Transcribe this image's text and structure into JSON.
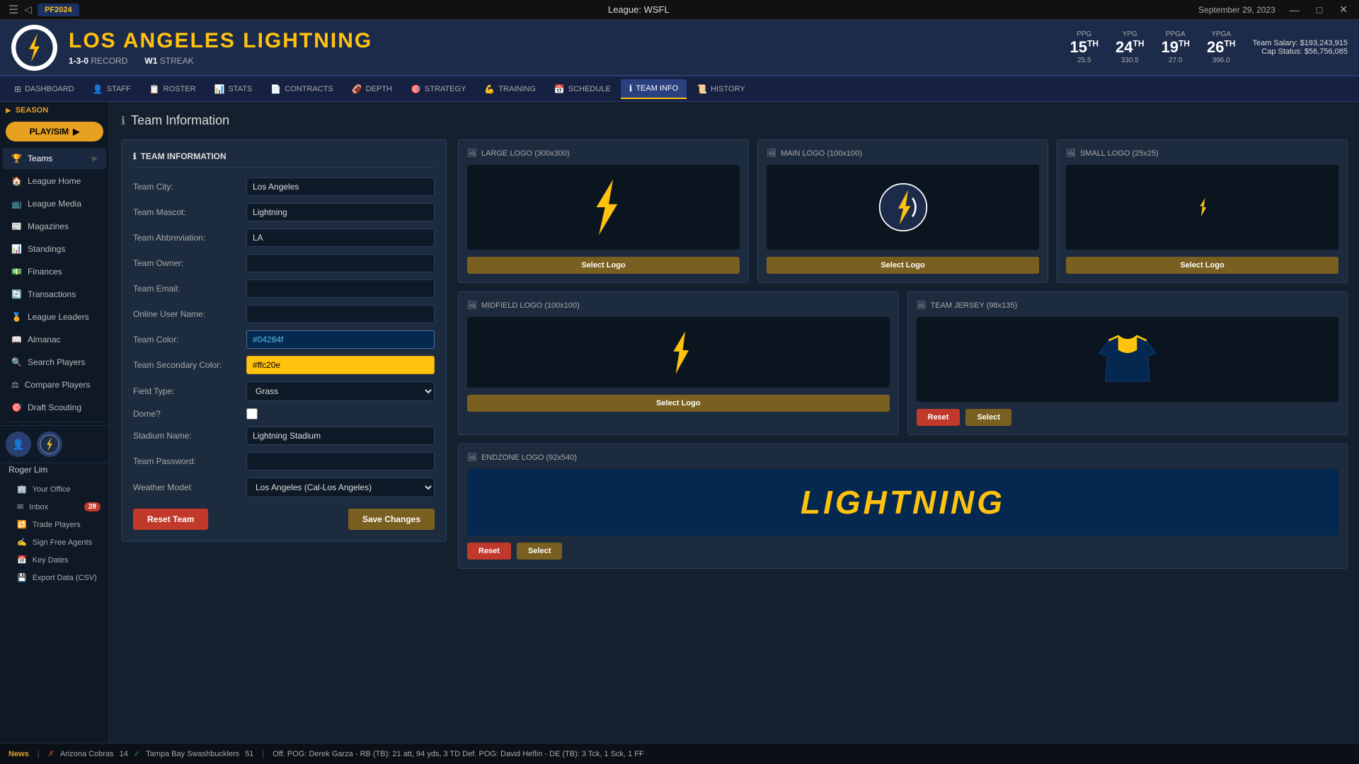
{
  "topbar": {
    "logo": "PF2024",
    "league": "League: WSFL",
    "date": "September 29, 2023",
    "minimize": "—",
    "maximize": "□",
    "close": "✕"
  },
  "header": {
    "team_city": "LOS ANGELES",
    "team_name": "LIGHTNING",
    "record": "1-3-0",
    "record_label": "RECORD",
    "streak": "W1",
    "streak_label": "STREAK",
    "stats": [
      {
        "label": "PPG",
        "rank": "15TH",
        "value": "25.5"
      },
      {
        "label": "YPG",
        "rank": "24TH",
        "value": "330.5"
      },
      {
        "label": "PPGA",
        "rank": "19TH",
        "value": "27.0"
      },
      {
        "label": "YPGA",
        "rank": "26TH",
        "value": "396.0"
      }
    ],
    "salary": "Team Salary: $193,243,915",
    "cap": "Cap Status: $56,756,085"
  },
  "nav_tabs": [
    {
      "id": "dashboard",
      "label": "DASHBOARD",
      "icon": "⊞"
    },
    {
      "id": "staff",
      "label": "STAFF",
      "icon": "👤"
    },
    {
      "id": "roster",
      "label": "ROSTER",
      "icon": "📋"
    },
    {
      "id": "stats",
      "label": "STATS",
      "icon": "📊"
    },
    {
      "id": "contracts",
      "label": "CONTRACTS",
      "icon": "📄"
    },
    {
      "id": "depth",
      "label": "DEPTH",
      "icon": "🏈"
    },
    {
      "id": "strategy",
      "label": "STRATEGY",
      "icon": "🎯"
    },
    {
      "id": "training",
      "label": "TRAINING",
      "icon": "💪"
    },
    {
      "id": "schedule",
      "label": "SCHEDULE",
      "icon": "📅"
    },
    {
      "id": "teaminfo",
      "label": "TEAM INFO",
      "icon": "ℹ"
    },
    {
      "id": "history",
      "label": "HISTORY",
      "icon": "📜"
    }
  ],
  "sidebar": {
    "season_label": "SEASON",
    "play_sim": "PLAY/SIM",
    "items": [
      {
        "id": "teams",
        "label": "Teams",
        "icon": "🏆"
      },
      {
        "id": "league-home",
        "label": "League Home",
        "icon": "🏠"
      },
      {
        "id": "league-media",
        "label": "League Media",
        "icon": "📺"
      },
      {
        "id": "magazines",
        "label": "Magazines",
        "icon": "📰"
      },
      {
        "id": "standings",
        "label": "Standings",
        "icon": "📊"
      },
      {
        "id": "finances",
        "label": "Finances",
        "icon": "💵"
      },
      {
        "id": "transactions",
        "label": "Transactions",
        "icon": "🔄"
      },
      {
        "id": "league-leaders",
        "label": "League Leaders",
        "icon": "🏅"
      },
      {
        "id": "almanac",
        "label": "Almanac",
        "icon": "📖"
      },
      {
        "id": "search-players",
        "label": "Search Players",
        "icon": "🔍"
      },
      {
        "id": "compare-players",
        "label": "Compare Players",
        "icon": "⚖"
      },
      {
        "id": "draft-scouting",
        "label": "Draft Scouting",
        "icon": "🎯"
      }
    ],
    "user_name": "Roger Lim",
    "sub_items": [
      {
        "id": "your-office",
        "label": "Your Office",
        "icon": "🏢"
      },
      {
        "id": "inbox",
        "label": "Inbox",
        "icon": "✉",
        "badge": "28"
      },
      {
        "id": "trade-players",
        "label": "Trade Players",
        "icon": "🔁"
      },
      {
        "id": "sign-free-agents",
        "label": "Sign Free Agents",
        "icon": "✍"
      },
      {
        "id": "key-dates",
        "label": "Key Dates",
        "icon": "📅"
      },
      {
        "id": "export-data",
        "label": "Export Data (CSV)",
        "icon": "💾"
      }
    ]
  },
  "page": {
    "title": "Team Information",
    "section_label": "TEAM INFORMATION",
    "fields": {
      "city_label": "Team City:",
      "city_value": "Los Angeles",
      "mascot_label": "Team Mascot:",
      "mascot_value": "Lightning",
      "abbr_label": "Team Abbreviation:",
      "abbr_value": "LA",
      "owner_label": "Team Owner:",
      "owner_value": "",
      "email_label": "Team Email:",
      "email_value": "",
      "username_label": "Online User Name:",
      "username_value": "",
      "color_label": "Team Color:",
      "color_value": "#04284f",
      "secondary_label": "Team Secondary Color:",
      "secondary_value": "#ffc20e",
      "field_label": "Field Type:",
      "field_value": "Grass",
      "dome_label": "Dome?",
      "stadium_label": "Stadium Name:",
      "stadium_value": "Lightning Stadium",
      "password_label": "Team Password:",
      "password_value": "",
      "weather_label": "Weather Model:",
      "weather_value": "Los Angeles (Cal-Los Angeles)"
    },
    "buttons": {
      "reset_team": "Reset Team",
      "save_changes": "Save Changes"
    },
    "logos": {
      "large_label": "LARGE LOGO (300x300)",
      "main_label": "MAIN LOGO (100x100)",
      "small_label": "SMALL LOGO (25x25)",
      "midfield_label": "MIDFIELD LOGO (100x100)",
      "jersey_label": "TEAM JERSEY (98x135)",
      "endzone_label": "ENDZONE LOGO (92x540)",
      "select_logo": "Select Logo",
      "reset": "Reset",
      "select": "Select",
      "endzone_text": "LIGHTNING"
    }
  },
  "statusbar": {
    "news_label": "News",
    "score1_away": "Arizona Cobras",
    "score1_away_pts": "14",
    "score1_home": "Tampa Bay Swashbucklers",
    "score1_home_pts": "51",
    "ticker": "Off. POG: Derek Garza - RB (TB): 21 att, 94 yds, 3 TD    Def. POG: David Heflin - DE (TB): 3 Tck, 1 Sck, 1 FF"
  }
}
